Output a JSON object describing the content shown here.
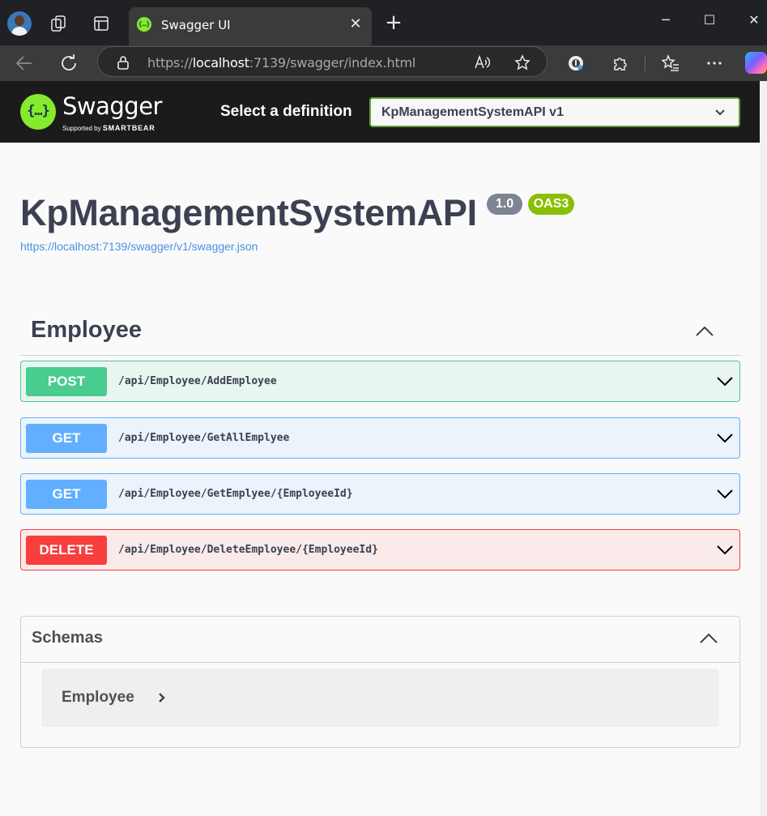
{
  "browser": {
    "tab_title": "Swagger UI",
    "url_scheme": "https://",
    "url_host": "localhost",
    "url_rest": ":7139/swagger/index.html"
  },
  "topbar": {
    "logo_name": "Swagger",
    "logo_supported": "Supported by",
    "logo_brand": "SMARTBEAR",
    "definition_label": "Select a definition",
    "definition_selected": "KpManagementSystemAPI v1"
  },
  "info": {
    "title": "KpManagementSystemAPI",
    "version": "1.0",
    "oas": "OAS3",
    "spec_url": "https://localhost:7139/swagger/v1/swagger.json"
  },
  "tag": {
    "name": "Employee",
    "operations": [
      {
        "method": "POST",
        "path": "/api/Employee/AddEmployee"
      },
      {
        "method": "GET",
        "path": "/api/Employee/GetAllEmplyee"
      },
      {
        "method": "GET",
        "path": "/api/Employee/GetEmplyee/{EmployeeId}"
      },
      {
        "method": "DELETE",
        "path": "/api/Employee/DeleteEmployee/{EmployeeId}"
      }
    ]
  },
  "schemas": {
    "title": "Schemas",
    "models": [
      {
        "name": "Employee"
      }
    ]
  },
  "icons": {
    "favicon": "swagger-icon",
    "lock": "lock-icon",
    "read_aloud": "read-aloud-icon",
    "favorite": "star-icon",
    "extensions": "puzzle-icon",
    "favorites_bar": "favorites-icon",
    "more": "more-icon"
  },
  "colors": {
    "post": "#49cc90",
    "get": "#61affe",
    "delete": "#f93e3e",
    "swagger_green": "#85ea2d"
  }
}
